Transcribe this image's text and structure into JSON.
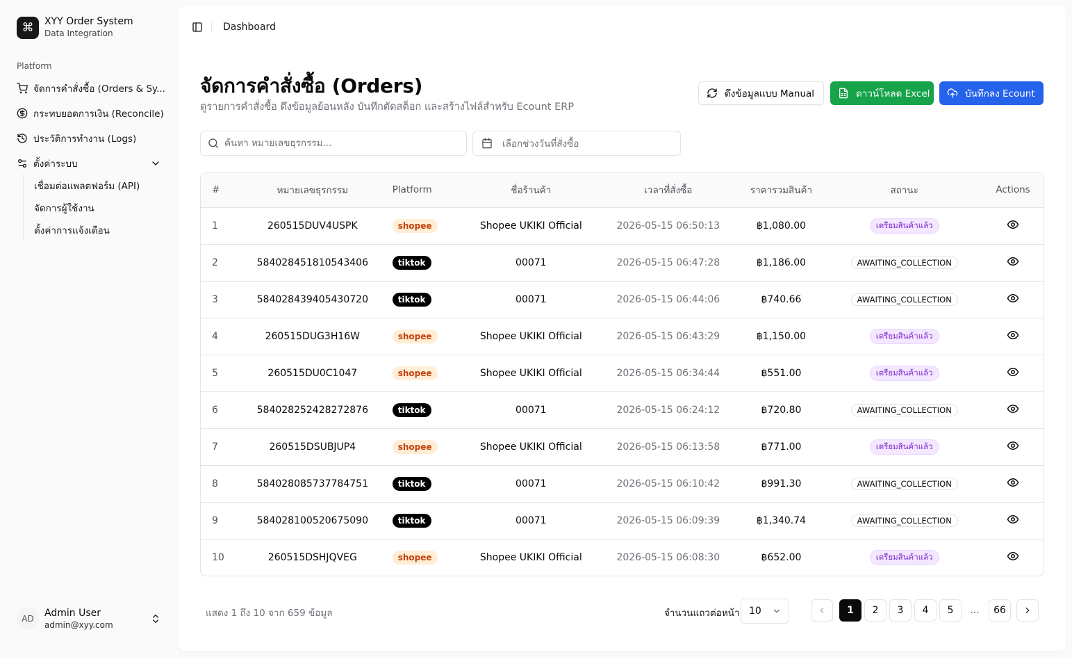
{
  "app": {
    "title": "XYY Order System",
    "subtitle": "Data Integration",
    "logo_icon": "command-icon"
  },
  "sidebar": {
    "group_label": "Platform",
    "items": [
      {
        "label": "จัดการคำสั่งซื้อ (Orders & Sy...",
        "icon": "cart-icon"
      },
      {
        "label": "กระทบยอดการเงิน (Reconcile)",
        "icon": "dollar-icon"
      },
      {
        "label": "ประวัติการทำงาน (Logs)",
        "icon": "history-icon"
      },
      {
        "label": "ตั้งค่าระบบ",
        "icon": "settings-sliders-icon"
      }
    ],
    "subitems": [
      {
        "label": "เชื่อมต่อแพลตฟอร์ม (API)"
      },
      {
        "label": "จัดการผู้ใช้งาน"
      },
      {
        "label": "ตั้งค่าการแจ้งเตือน"
      }
    ]
  },
  "user": {
    "initials": "AD",
    "name": "Admin User",
    "email": "admin@xyy.com"
  },
  "topbar": {
    "breadcrumb": "Dashboard"
  },
  "page": {
    "title": "จัดการคำสั่งซื้อ (Orders)",
    "description": "ดูรายการคำสั่งซื้อ ดึงข้อมูลย้อนหลัง บันทึกตัดสต็อก และสร้างไฟล์สำหรับ Ecount ERP"
  },
  "actions": {
    "manual_fetch": "ดึงข้อมูลแบบ Manual",
    "download_excel": "ดาวน์โหลด Excel",
    "save_ecount": "บันทึกลง Ecount"
  },
  "filters": {
    "search_placeholder": "ค้นหา หมายเลขธุรกรรม...",
    "date_placeholder": "เลือกช่วงวันที่สั่งซื้อ"
  },
  "table": {
    "columns": [
      "#",
      "หมายเลขธุรกรรม",
      "Platform",
      "ชื่อร้านค้า",
      "เวลาที่สั่งซื้อ",
      "ราคารวมสินค้า",
      "สถานะ",
      "Actions"
    ],
    "rows": [
      {
        "num": "1",
        "txn": "260515DUV4USPK",
        "platform": "shopee",
        "shop": "Shopee UKIKI Official",
        "time": "2026-05-15 06:50:13",
        "price": "฿1,080.00",
        "status": "เตรียมสินค้าแล้ว",
        "status_type": "purple"
      },
      {
        "num": "2",
        "txn": "584028451810543406",
        "platform": "tiktok",
        "shop": "00071",
        "time": "2026-05-15 06:47:28",
        "price": "฿1,186.00",
        "status": "AWAITING_COLLECTION",
        "status_type": "outline"
      },
      {
        "num": "3",
        "txn": "584028439405430720",
        "platform": "tiktok",
        "shop": "00071",
        "time": "2026-05-15 06:44:06",
        "price": "฿740.66",
        "status": "AWAITING_COLLECTION",
        "status_type": "outline"
      },
      {
        "num": "4",
        "txn": "260515DUG3H16W",
        "platform": "shopee",
        "shop": "Shopee UKIKI Official",
        "time": "2026-05-15 06:43:29",
        "price": "฿1,150.00",
        "status": "เตรียมสินค้าแล้ว",
        "status_type": "purple"
      },
      {
        "num": "5",
        "txn": "260515DU0C1047",
        "platform": "shopee",
        "shop": "Shopee UKIKI Official",
        "time": "2026-05-15 06:34:44",
        "price": "฿551.00",
        "status": "เตรียมสินค้าแล้ว",
        "status_type": "purple"
      },
      {
        "num": "6",
        "txn": "584028252428272876",
        "platform": "tiktok",
        "shop": "00071",
        "time": "2026-05-15 06:24:12",
        "price": "฿720.80",
        "status": "AWAITING_COLLECTION",
        "status_type": "outline"
      },
      {
        "num": "7",
        "txn": "260515DSUBJUP4",
        "platform": "shopee",
        "shop": "Shopee UKIKI Official",
        "time": "2026-05-15 06:13:58",
        "price": "฿771.00",
        "status": "เตรียมสินค้าแล้ว",
        "status_type": "purple"
      },
      {
        "num": "8",
        "txn": "584028085737784751",
        "platform": "tiktok",
        "shop": "00071",
        "time": "2026-05-15 06:10:42",
        "price": "฿991.30",
        "status": "AWAITING_COLLECTION",
        "status_type": "outline"
      },
      {
        "num": "9",
        "txn": "584028100520675090",
        "platform": "tiktok",
        "shop": "00071",
        "time": "2026-05-15 06:09:39",
        "price": "฿1,340.74",
        "status": "AWAITING_COLLECTION",
        "status_type": "outline"
      },
      {
        "num": "10",
        "txn": "260515DSHJQVEG",
        "platform": "shopee",
        "shop": "Shopee UKIKI Official",
        "time": "2026-05-15 06:08:30",
        "price": "฿652.00",
        "status": "เตรียมสินค้าแล้ว",
        "status_type": "purple"
      }
    ]
  },
  "pagination": {
    "info": "แสดง 1 ถึง 10 จาก 659 ข้อมูล",
    "rows_per_page_label": "จำนวนแถวต่อหน้า",
    "rows_per_page": "10",
    "pages": [
      "1",
      "2",
      "3",
      "4",
      "5",
      "...",
      "66"
    ],
    "current_page": "1"
  },
  "colors": {
    "accent_green": "#16a34a",
    "accent_blue": "#2563eb",
    "shopee_bg": "#ffedd5",
    "shopee_text": "#c2410c",
    "tiktok_bg": "#000000",
    "status_purple": "#7e22ce"
  }
}
